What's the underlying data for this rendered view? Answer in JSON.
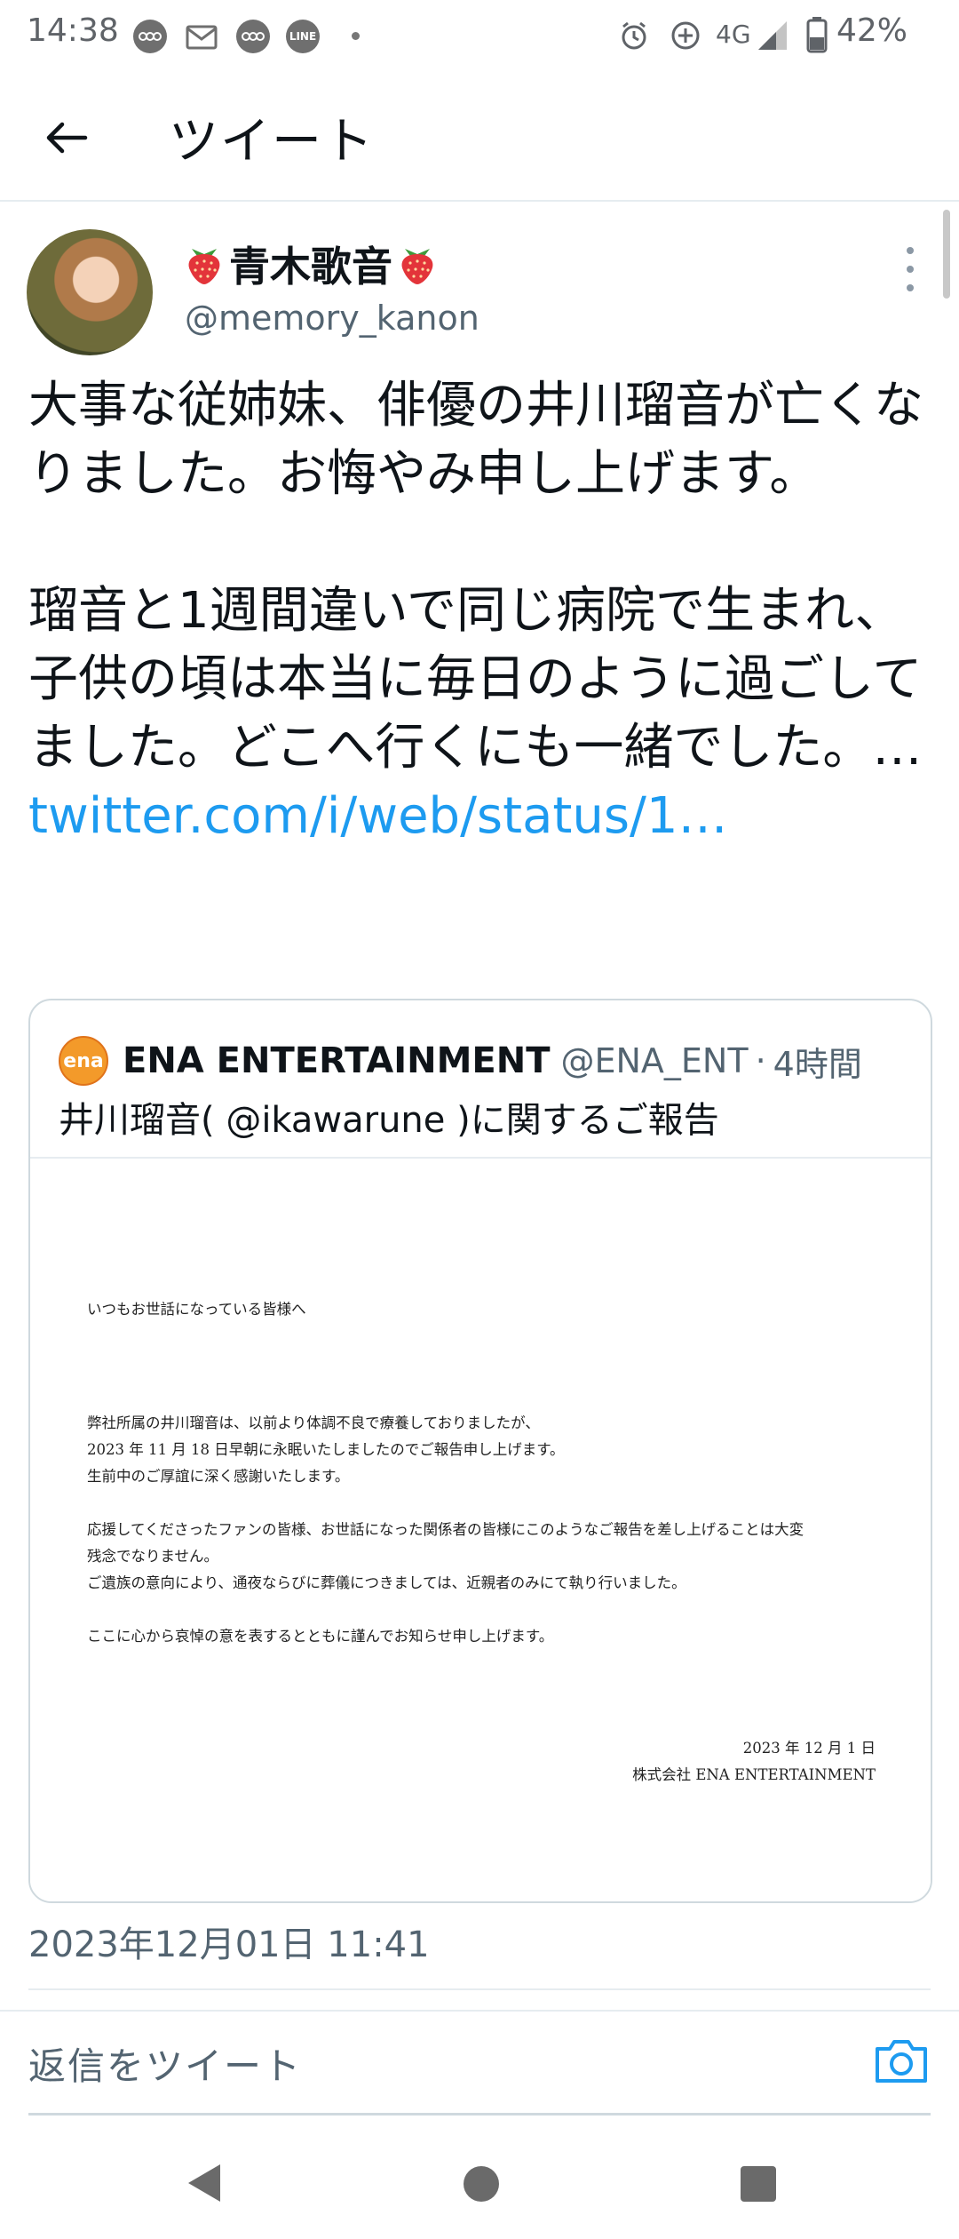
{
  "status_bar": {
    "time": "14:38",
    "notif_icons": [
      "circle-notification-icon",
      "mail-notification-icon",
      "circle-notification-icon",
      "line-app-icon"
    ],
    "line_label": "LINE",
    "network": "4G",
    "battery": "42%"
  },
  "header": {
    "title": "ツイート"
  },
  "tweet": {
    "author_name": "青木歌音",
    "author_handle": "@memory_kanon",
    "text_main": "大事な従姉妹、俳優の井川瑠音が亡くなりました。お悔やみ申し上げます。\n\n瑠音と1週間違いで同じ病院で生まれ、子供の頃は本当に毎日のように過ごしてました。どこへ行くにも一緒でした。… ",
    "link_text": "twitter.com/i/web/status/1…",
    "timestamp": "2023年12月01日 11:41"
  },
  "quote": {
    "logo_text": "ena",
    "author": "ENA ENTERTAINMENT",
    "handle": "@ENA_ENT",
    "separator": "·",
    "time": "4時間",
    "text": "井川瑠音( @ikawarune )に関するご報告",
    "document": {
      "greeting": "いつもお世話になっている皆様へ",
      "p1_l1": "弊社所属の井川瑠音は、以前より体調不良で療養しておりましたが、",
      "p1_l2": "2023 年 11 月 18 日早朝に永眠いたしましたのでご報告申し上げます。",
      "p1_l3": "生前中のご厚誼に深く感謝いたします。",
      "p2_l1": "応援してくださったファンの皆様、お世話になった関係者の皆様にこのようなご報告を差し上げることは大変",
      "p2_l2": "残念でなりません。",
      "p2_l3": "ご遺族の意向により、通夜ならびに葬儀につきましては、近親者のみにて執り行いました。",
      "p3_l1": "ここに心から哀悼の意を表するとともに謹んでお知らせ申し上げます。",
      "date": "2023 年 12 月 1 日",
      "company": "株式会社 ENA ENTERTAINMENT"
    }
  },
  "reply": {
    "placeholder": "返信をツイート"
  },
  "colors": {
    "link": "#1d9bf0",
    "secondary_text": "#536471"
  }
}
